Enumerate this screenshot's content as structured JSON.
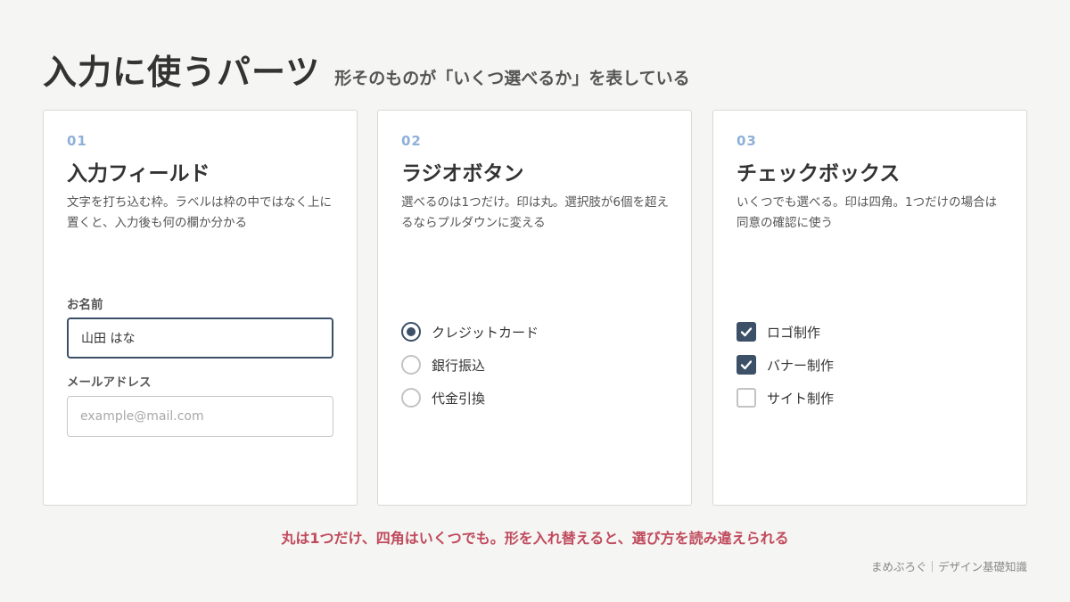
{
  "header": {
    "title": "入力に使うパーツ",
    "subtitle": "形そのものが「いくつ選べるか」を表している"
  },
  "cards": [
    {
      "number": "01",
      "title": "入力フィールド",
      "description": "文字を打ち込む枠。ラベルは枠の中ではなく上に置くと、入力後も何の欄か分かる",
      "fields": [
        {
          "label": "お名前",
          "value": "山田 はな",
          "placeholder": ""
        },
        {
          "label": "メールアドレス",
          "value": "",
          "placeholder": "example@mail.com"
        }
      ]
    },
    {
      "number": "02",
      "title": "ラジオボタン",
      "description": "選べるのは1つだけ。印は丸。選択肢が6個を超えるならプルダウンに変える",
      "options": [
        {
          "label": "クレジットカード",
          "selected": true
        },
        {
          "label": "銀行振込",
          "selected": false
        },
        {
          "label": "代金引換",
          "selected": false
        }
      ]
    },
    {
      "number": "03",
      "title": "チェックボックス",
      "description": "いくつでも選べる。印は四角。1つだけの場合は同意の確認に使う",
      "options": [
        {
          "label": "ロゴ制作",
          "checked": true
        },
        {
          "label": "バナー制作",
          "checked": true
        },
        {
          "label": "サイト制作",
          "checked": false
        }
      ]
    }
  ],
  "footnote": "丸は1つだけ、四角はいくつでも。形を入れ替えると、選び方を読み違えられる",
  "credit": "まめぶろぐ｜デザイン基礎知識",
  "colors": {
    "accent": "#3c5068",
    "number": "#8fb0d8",
    "footnote": "#c04a5c",
    "background": "#f5f5f3"
  }
}
